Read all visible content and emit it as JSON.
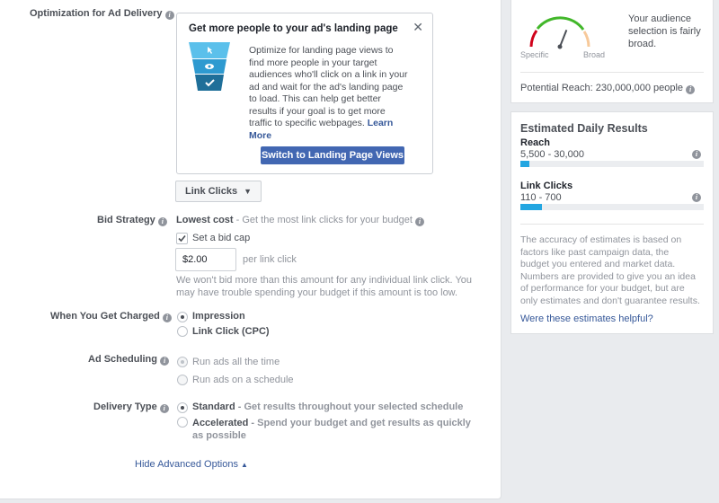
{
  "optimization": {
    "label": "Optimization for Ad Delivery",
    "tip_title": "Get more people to your ad's landing page",
    "tip_body": "Optimize for landing page views to find more people in your target audiences who'll click on a link in your ad and wait for the ad's landing page to load. This can help get better results if your goal is to get more traffic to specific webpages.",
    "tip_learn_more": "Learn More",
    "switch_button": "Switch to Landing Page Views",
    "dropdown_value": "Link Clicks"
  },
  "bid": {
    "label": "Bid Strategy",
    "strategy_bold": "Lowest cost",
    "strategy_desc": " - Get the most link clicks for your budget",
    "cap_label": "Set a bid cap",
    "cap_checked": true,
    "cap_value": "$2.00",
    "cap_unit": "per link click",
    "warning": "We won't bid more than this amount for any individual link click. You may have trouble spending your budget if this amount is too low."
  },
  "charged": {
    "label": "When You Get Charged",
    "options": [
      "Impression",
      "Link Click (CPC)"
    ],
    "selected": 0
  },
  "scheduling": {
    "label": "Ad Scheduling",
    "options": [
      "Run ads all the time",
      "Run ads on a schedule"
    ],
    "selected": 0
  },
  "delivery": {
    "label": "Delivery Type",
    "options": [
      {
        "title": "Standard",
        "desc": " - Get results throughout your selected schedule"
      },
      {
        "title": "Accelerated",
        "desc": " - Spend your budget and get results as quickly as possible"
      }
    ],
    "selected": 0
  },
  "hide_advanced": "Hide Advanced Options",
  "audience": {
    "gauge_specific": "Specific",
    "gauge_broad": "Broad",
    "gauge_value": 0.62,
    "text": "Your audience selection is fairly broad.",
    "potential_reach": "Potential Reach: 230,000,000 people"
  },
  "estimates": {
    "title": "Estimated Daily Results",
    "reach_label": "Reach",
    "reach_range": "5,500 - 30,000",
    "reach_fill": 0.05,
    "clicks_label": "Link Clicks",
    "clicks_range": "110 - 700",
    "clicks_fill": 0.12,
    "disclaimer": "The accuracy of estimates is based on factors like past campaign data, the budget you entered and market data. Numbers are provided to give you an idea of performance for your budget, but are only estimates and don't guarantee results.",
    "helpful_link": "Were these estimates helpful?"
  },
  "colors": {
    "brand_blue": "#4267b2",
    "bar_blue": "#23a6e1",
    "link": "#365899"
  }
}
